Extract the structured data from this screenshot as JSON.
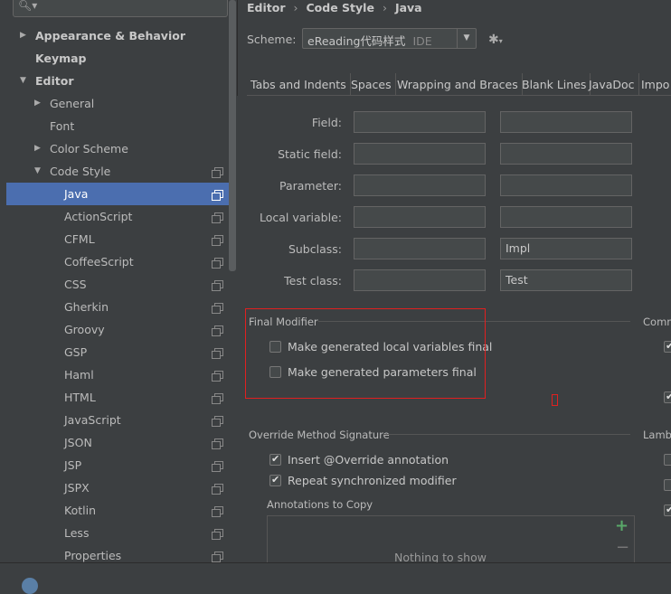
{
  "sidebar": {
    "search": {
      "value": ""
    },
    "items": [
      {
        "label": "Appearance & Behavior",
        "bold": true,
        "arrow": "▶"
      },
      {
        "label": "Keymap",
        "bold": true,
        "arrow": ""
      },
      {
        "label": "Editor",
        "bold": true,
        "arrow": "▼"
      },
      {
        "label": "General",
        "arrow": "▶"
      },
      {
        "label": "Font",
        "arrow": ""
      },
      {
        "label": "Color Scheme",
        "arrow": "▶"
      },
      {
        "label": "Code Style",
        "arrow": "▼"
      },
      {
        "label": "Java",
        "selected": true
      },
      {
        "label": "ActionScript"
      },
      {
        "label": "CFML"
      },
      {
        "label": "CoffeeScript"
      },
      {
        "label": "CSS"
      },
      {
        "label": "Gherkin"
      },
      {
        "label": "Groovy"
      },
      {
        "label": "GSP"
      },
      {
        "label": "Haml"
      },
      {
        "label": "HTML"
      },
      {
        "label": "JavaScript"
      },
      {
        "label": "JSON"
      },
      {
        "label": "JSP"
      },
      {
        "label": "JSPX"
      },
      {
        "label": "Kotlin"
      },
      {
        "label": "Less"
      },
      {
        "label": "Properties"
      }
    ]
  },
  "breadcrumb": {
    "part1": "Editor",
    "part2": "Code Style",
    "part3": "Java",
    "sep": "›"
  },
  "scheme": {
    "label": "Scheme:",
    "value": "eReading代码样式",
    "hint": "IDE"
  },
  "tabs": [
    "Tabs and Indents",
    "Spaces",
    "Wrapping and Braces",
    "Blank Lines",
    "JavaDoc",
    "Impo"
  ],
  "naming": {
    "rows": [
      {
        "label": "Field:",
        "prefix": "",
        "suffix": ""
      },
      {
        "label": "Static field:",
        "prefix": "",
        "suffix": ""
      },
      {
        "label": "Parameter:",
        "prefix": "",
        "suffix": ""
      },
      {
        "label": "Local variable:",
        "prefix": "",
        "suffix": ""
      },
      {
        "label": "Subclass:",
        "prefix": "",
        "suffix": "Impl"
      },
      {
        "label": "Test class:",
        "prefix": "",
        "suffix": "Test"
      }
    ]
  },
  "final_modifier": {
    "title": "Final Modifier",
    "options": [
      {
        "label": "Make generated local variables final",
        "checked": false
      },
      {
        "label": "Make generated parameters final",
        "checked": false
      }
    ]
  },
  "comment_group": {
    "title": "Comm"
  },
  "override_group": {
    "title": "Override Method Signature",
    "options": [
      {
        "label": "Insert @Override annotation",
        "checked": true
      },
      {
        "label": "Repeat synchronized modifier",
        "checked": true
      }
    ]
  },
  "lambda_group": {
    "title": "Lamb"
  },
  "annotations": {
    "title": "Annotations to Copy",
    "empty_text": "Nothing to show",
    "add": "+",
    "remove": "−"
  },
  "colors": {
    "accent": "#4b6eaf",
    "highlight": "#e02020",
    "add_green": "#59a869"
  }
}
